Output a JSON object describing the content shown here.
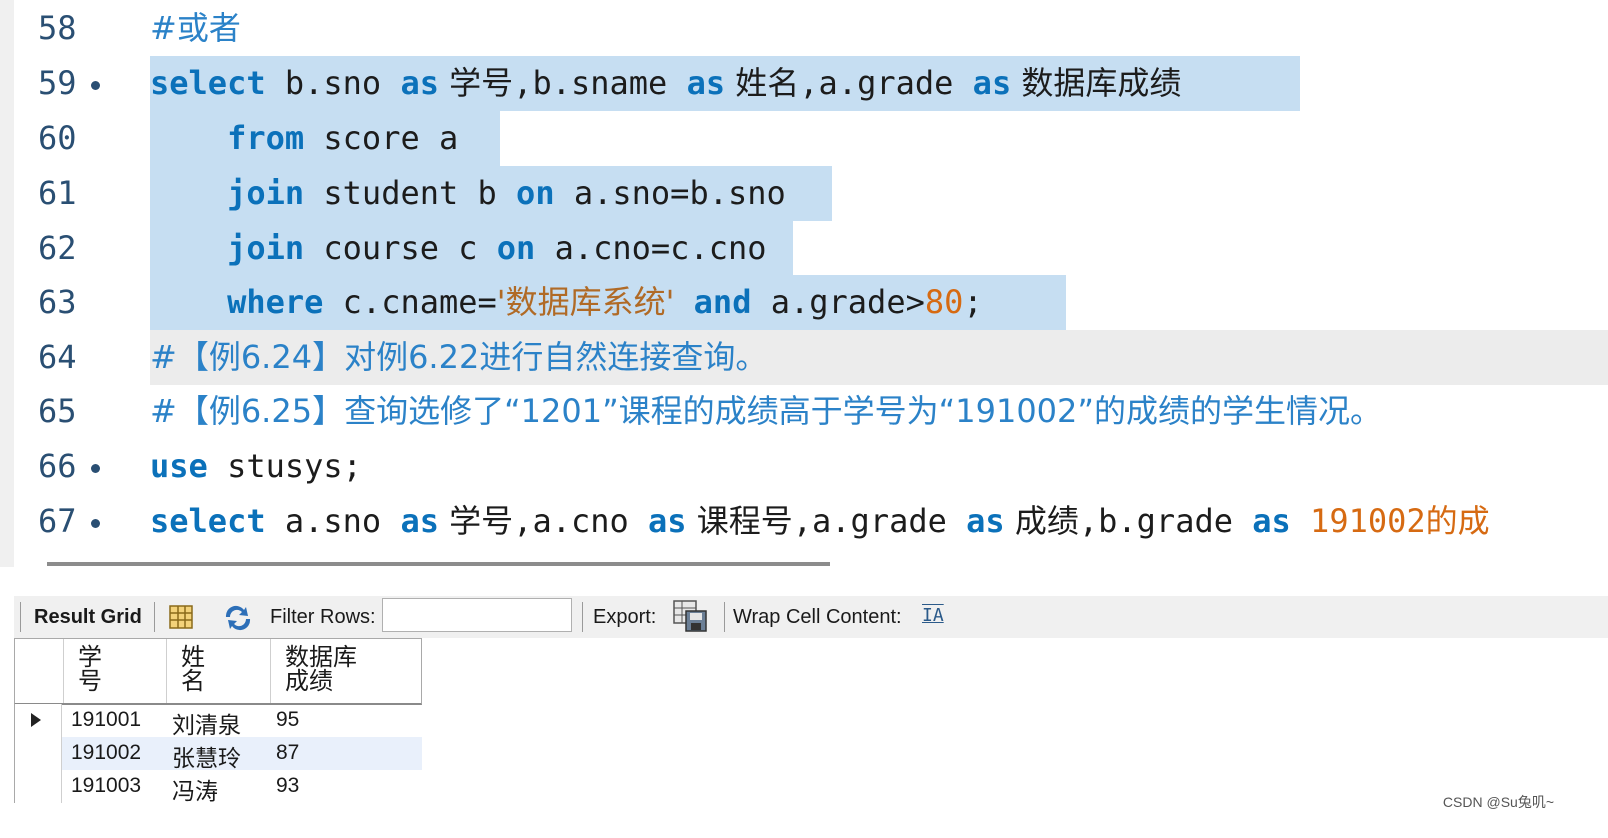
{
  "editor": {
    "lines": [
      {
        "num": "58",
        "bullet": false,
        "segments": [
          {
            "t": "#或者",
            "c": "cm zh"
          }
        ]
      },
      {
        "num": "59",
        "bullet": true,
        "segments": [
          {
            "t": "select",
            "c": "kw"
          },
          {
            "t": " b.sno ",
            "c": ""
          },
          {
            "t": "as",
            "c": "kw"
          },
          {
            "t": " 学号",
            "c": "zh"
          },
          {
            "t": ",b.sname ",
            "c": ""
          },
          {
            "t": "as",
            "c": "kw"
          },
          {
            "t": " 姓名",
            "c": "zh"
          },
          {
            "t": ",a.grade ",
            "c": ""
          },
          {
            "t": "as",
            "c": "kw"
          },
          {
            "t": " 数据库成绩",
            "c": "zh"
          }
        ]
      },
      {
        "num": "60",
        "bullet": false,
        "segments": [
          {
            "t": "    ",
            "c": ""
          },
          {
            "t": "from",
            "c": "kw"
          },
          {
            "t": " score a",
            "c": ""
          }
        ]
      },
      {
        "num": "61",
        "bullet": false,
        "segments": [
          {
            "t": "    ",
            "c": ""
          },
          {
            "t": "join",
            "c": "kw"
          },
          {
            "t": " student b ",
            "c": ""
          },
          {
            "t": "on",
            "c": "kw"
          },
          {
            "t": " a.sno=b.sno",
            "c": ""
          }
        ]
      },
      {
        "num": "62",
        "bullet": false,
        "segments": [
          {
            "t": "    ",
            "c": ""
          },
          {
            "t": "join",
            "c": "kw"
          },
          {
            "t": " course c ",
            "c": ""
          },
          {
            "t": "on",
            "c": "kw"
          },
          {
            "t": " a.cno=c.cno",
            "c": ""
          }
        ]
      },
      {
        "num": "63",
        "bullet": false,
        "segments": [
          {
            "t": "    ",
            "c": ""
          },
          {
            "t": "where",
            "c": "kw"
          },
          {
            "t": " c.cname=",
            "c": ""
          },
          {
            "t": "'数据库系统'",
            "c": "str zh"
          },
          {
            "t": " ",
            "c": ""
          },
          {
            "t": "and",
            "c": "kw"
          },
          {
            "t": " a.grade>",
            "c": ""
          },
          {
            "t": "80",
            "c": "num"
          },
          {
            "t": ";",
            "c": ""
          }
        ]
      },
      {
        "num": "64",
        "bullet": false,
        "segments": [
          {
            "t": "#【例6.24】对例6.22进行自然连接查询。",
            "c": "cm zh"
          }
        ]
      },
      {
        "num": "65",
        "bullet": false,
        "segments": [
          {
            "t": "#【例6.25】查询选修了“1201”课程的成绩高于学号为“191002”的成绩的学生情况。",
            "c": "cm zh"
          }
        ]
      },
      {
        "num": "66",
        "bullet": true,
        "segments": [
          {
            "t": "use",
            "c": "kw"
          },
          {
            "t": " stusys;",
            "c": ""
          }
        ]
      },
      {
        "num": "67",
        "bullet": true,
        "segments": [
          {
            "t": "select",
            "c": "kw"
          },
          {
            "t": " a.sno ",
            "c": ""
          },
          {
            "t": "as",
            "c": "kw"
          },
          {
            "t": " 学号",
            "c": "zh"
          },
          {
            "t": ",a.cno ",
            "c": ""
          },
          {
            "t": "as",
            "c": "kw"
          },
          {
            "t": " 课程号",
            "c": "zh"
          },
          {
            "t": ",a.grade ",
            "c": ""
          },
          {
            "t": "as",
            "c": "kw"
          },
          {
            "t": " 成绩",
            "c": "zh"
          },
          {
            "t": ",b.grade ",
            "c": ""
          },
          {
            "t": "as",
            "c": "kw"
          },
          {
            "t": " ",
            "c": ""
          },
          {
            "t": "191002",
            "c": "num"
          },
          {
            "t": "的成",
            "c": "num zh"
          }
        ]
      }
    ]
  },
  "toolbar": {
    "result_grid_label": "Result Grid",
    "filter_rows_label": "Filter Rows:",
    "filter_value": "",
    "export_label": "Export:",
    "wrap_label": "Wrap Cell Content:",
    "wrap_icon_glyph": "IA"
  },
  "grid": {
    "columns": [
      {
        "l1": "学",
        "l2": "号"
      },
      {
        "l1": "姓",
        "l2": "名"
      },
      {
        "l1": "数据库",
        "l2": "成绩"
      }
    ],
    "rows": [
      {
        "c0": "191001",
        "c1": "刘清泉",
        "c2": "95",
        "current": true
      },
      {
        "c0": "191002",
        "c1": "张慧玲",
        "c2": "87",
        "current": false
      },
      {
        "c0": "191003",
        "c1": "冯涛",
        "c2": "93",
        "current": false
      }
    ]
  },
  "watermark": "CSDN @Su兔叽~",
  "colors": {
    "keyword": "#0b71ba",
    "comment": "#2b82c8",
    "selection": "#c6def2",
    "number": "#d66a12",
    "string": "#b06a26"
  }
}
